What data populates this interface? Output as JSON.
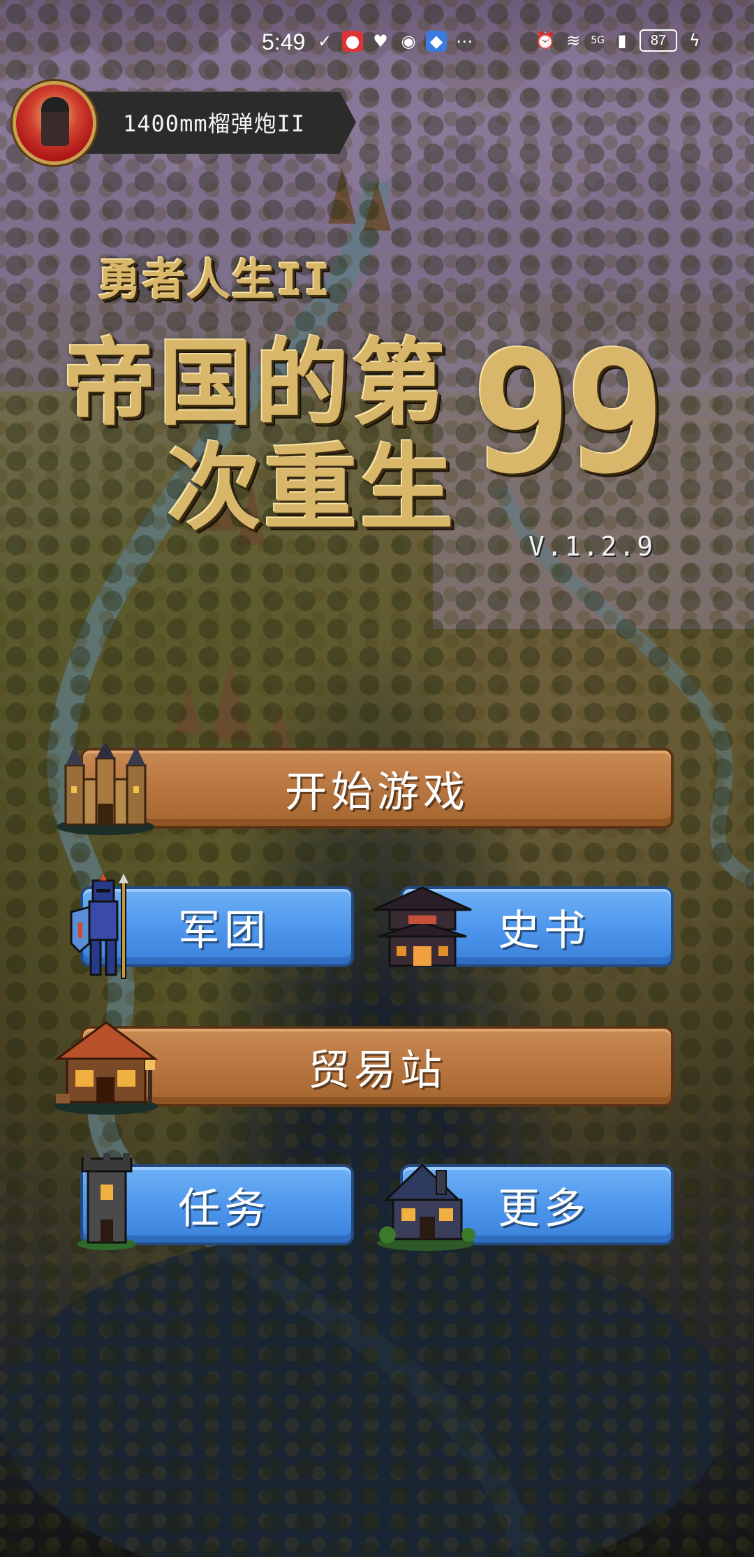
{
  "status_bar": {
    "time": "5:49",
    "battery": "87",
    "network": "5G"
  },
  "player": {
    "name": "1400mm榴弹炮II"
  },
  "title": {
    "subtitle": "勇者人生II",
    "line1": "帝国的第",
    "line2": "次重生",
    "number": "99",
    "version": "V.1.2.9"
  },
  "menu": {
    "start_game": "开始游戏",
    "legion": "军团",
    "history": "史书",
    "trading_post": "贸易站",
    "tasks": "任务",
    "more": "更多"
  },
  "colors": {
    "wide_button": "#b87540",
    "blue_button": "#4c95ec",
    "title_gold": "#d9b76a"
  }
}
